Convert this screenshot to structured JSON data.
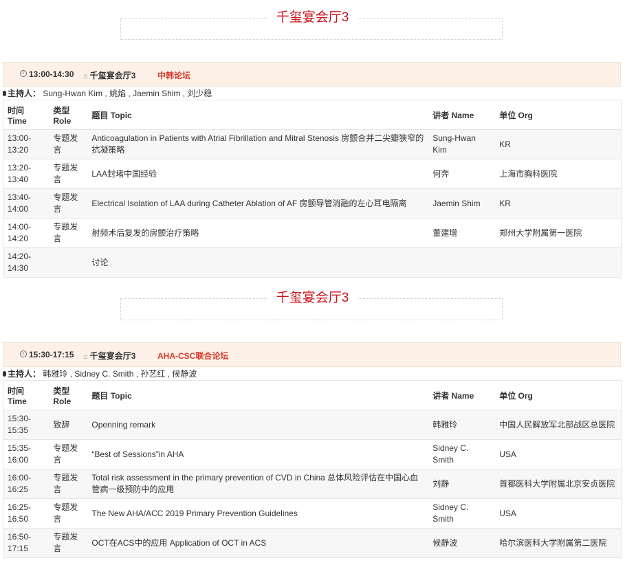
{
  "sessions": [
    {
      "hall_title": "千玺宴会厅3",
      "time": "13:00-14:30",
      "place": "千玺宴会厅3",
      "forum": "中韩论坛",
      "host_label": "主持人：",
      "hosts": "Sung-Hwan Kim , 姚焰 , Jaemin Shim , 刘少稳",
      "headers": {
        "time": "时间 Time",
        "role": "类型 Role",
        "topic": "题目 Topic",
        "speaker": "讲者 Name",
        "org": "单位 Org"
      },
      "rows": [
        {
          "time": "13:00-13:20",
          "role": "专题发言",
          "topic": "Anticoagulation in Patients with Atrial Fibrillation and Mitral Stenosis 房颤合并二尖瓣狭窄的抗凝策略",
          "speaker": "Sung-Hwan Kim",
          "org": "KR"
        },
        {
          "time": "13:20-13:40",
          "role": "专题发言",
          "topic": "LAA封堵中国经验",
          "speaker": "何奔",
          "org": "上海市胸科医院"
        },
        {
          "time": "13:40-14:00",
          "role": "专题发言",
          "topic": "Electrical Isolation of LAA during Catheter Ablation of AF 房颤导管消融的左心耳电隔离",
          "speaker": "Jaemin Shim",
          "org": "KR"
        },
        {
          "time": "14:00-14:20",
          "role": "专题发言",
          "topic": "射频术后复发的房颤治疗策略",
          "speaker": "董建增",
          "org": "郑州大学附属第一医院"
        },
        {
          "time": "14:20-14:30",
          "role": "",
          "topic": "讨论",
          "speaker": "",
          "org": ""
        }
      ]
    },
    {
      "hall_title": "千玺宴会厅3",
      "time": "15:30-17:15",
      "place": "千玺宴会厅3",
      "forum": "AHA-CSC联合论坛",
      "host_label": "主持人：",
      "hosts": "韩雅玲 , Sidney C. Smith , 孙艺红 , 候静波",
      "headers": {
        "time": "时间 Time",
        "role": "类型 Role",
        "topic": "题目 Topic",
        "speaker": "讲者 Name",
        "org": "单位 Org"
      },
      "rows": [
        {
          "time": "15:30-15:35",
          "role": "致辞",
          "topic": "Openning remark",
          "speaker": "韩雅玲",
          "org": "中国人民解放军北部战区总医院"
        },
        {
          "time": "15:35-16:00",
          "role": "专题发言",
          "topic": "“Best of Sessions”in AHA",
          "speaker": "Sidney C. Smith",
          "org": "USA"
        },
        {
          "time": "16:00-16:25",
          "role": "专题发言",
          "topic": "Total risk assessment in the primary prevention of CVD in China 总体风险评估在中国心血管病一级预防中的应用",
          "speaker": "刘静",
          "org": "首都医科大学附属北京安贞医院"
        },
        {
          "time": "16:25-16:50",
          "role": "专题发言",
          "topic": "The New AHA/ACC 2019 Primary Prevention Guidelines",
          "speaker": "Sidney C. Smith",
          "org": "USA"
        },
        {
          "time": "16:50-17:15",
          "role": "专题发言",
          "topic": "OCT在ACS中的应用 Application of OCT in ACS",
          "speaker": "候静波",
          "org": "哈尔滨医科大学附属第二医院"
        }
      ]
    }
  ]
}
